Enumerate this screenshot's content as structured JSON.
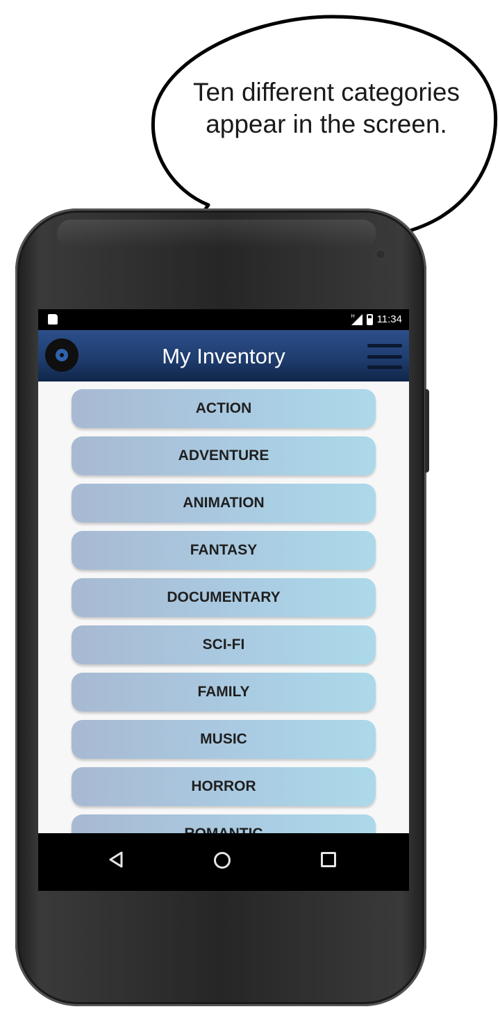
{
  "callout": {
    "text": "Ten different categories appear in the screen."
  },
  "status_bar": {
    "time": "11:34",
    "signal_label": "H"
  },
  "header": {
    "title": "My Inventory",
    "logo_icon": "disc-icon",
    "menu_icon": "hamburger-menu-icon",
    "colors": {
      "top": "#2c4f8a",
      "bottom": "#102649"
    }
  },
  "categories": [
    "ACTION",
    "ADVENTURE",
    "ANIMATION",
    "FANTASY",
    "DOCUMENTARY",
    "SCI-FI",
    "FAMILY",
    "MUSIC",
    "HORROR",
    "ROMANTIC"
  ],
  "nav_bar": {
    "buttons": [
      "back-icon",
      "home-icon",
      "recents-icon"
    ]
  }
}
